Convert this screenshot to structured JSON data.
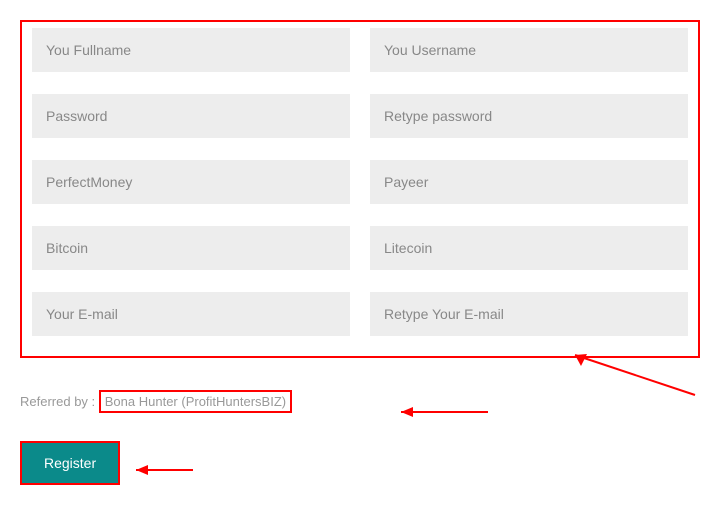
{
  "form": {
    "fullname": {
      "placeholder": "You Fullname"
    },
    "username": {
      "placeholder": "You Username"
    },
    "password": {
      "placeholder": "Password"
    },
    "retype_password": {
      "placeholder": "Retype password"
    },
    "perfectmoney": {
      "placeholder": "PerfectMoney"
    },
    "payeer": {
      "placeholder": "Payeer"
    },
    "bitcoin": {
      "placeholder": "Bitcoin"
    },
    "litecoin": {
      "placeholder": "Litecoin"
    },
    "email": {
      "placeholder": "Your E-mail"
    },
    "retype_email": {
      "placeholder": "Retype Your E-mail"
    }
  },
  "referred": {
    "label": "Referred by : ",
    "value": "Bona Hunter (ProfitHuntersBIZ)"
  },
  "actions": {
    "register": "Register"
  }
}
